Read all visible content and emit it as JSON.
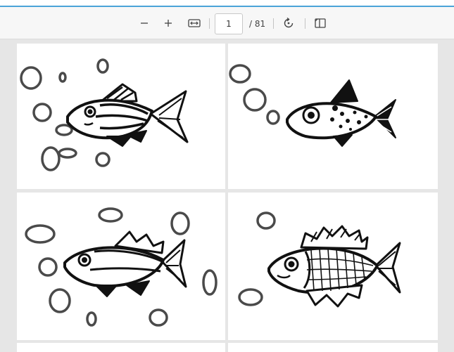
{
  "toolbar": {
    "zoom_out_icon": "minus-icon",
    "zoom_in_icon": "plus-icon",
    "fit_width_icon": "fit-width-icon",
    "current_page": "1",
    "page_total": "/ 81",
    "rotate_icon": "rotate-icon",
    "page_view_icon": "page-view-icon"
  },
  "document": {
    "pages": [
      {
        "content": "fish-with-bubbles-illustration"
      },
      {
        "content": "spotted-fish-with-bubbles-illustration"
      },
      {
        "content": "fish-with-bubbles-illustration"
      },
      {
        "content": "scaled-fish-with-bubbles-illustration"
      }
    ]
  },
  "colors": {
    "accent": "#4aa3d8",
    "toolbar_bg": "#f7f7f7",
    "viewer_bg": "#e6e6e6"
  }
}
